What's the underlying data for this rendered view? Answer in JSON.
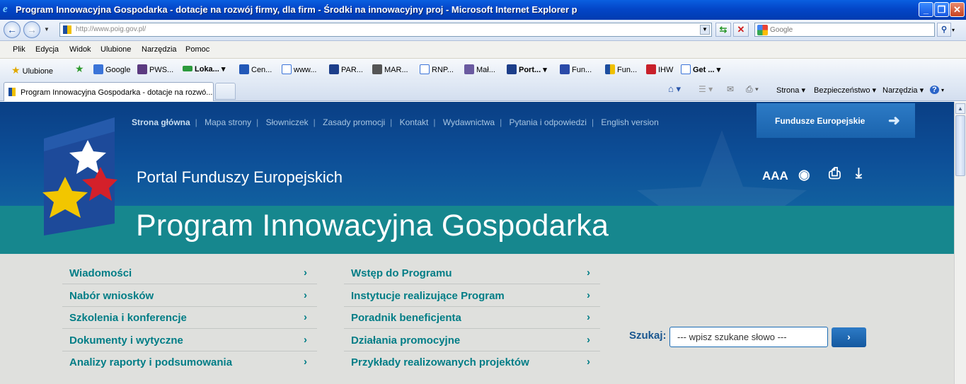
{
  "window": {
    "title": "Program Innowacyjna Gospodarka - dotacje na rozwój firmy, dla firm - Środki na innowacyjny proj - Microsoft Internet Explorer p",
    "minimize": "_",
    "maximize": "❐",
    "close": "✕"
  },
  "address": {
    "url": "http://www.poig.gov.pl/",
    "search_placeholder": "Google"
  },
  "menubar": [
    "Plik",
    "Edycja",
    "Widok",
    "Ulubione",
    "Narzędzia",
    "Pomoc"
  ],
  "favorites": {
    "label": "Ulubione",
    "items": [
      "Google",
      "PWS...",
      "Loka...",
      "Cen...",
      "www...",
      "PAR...",
      "MAR...",
      "RNP...",
      "Mał...",
      "Port...",
      "Fun...",
      "Fun...",
      "IHW",
      "Get ..."
    ]
  },
  "tabs": {
    "active": "Program Innowacyjna Gospodarka - dotacje na rozwó..."
  },
  "commandbar": {
    "strona": "Strona ▾",
    "bezpieczenstwo": "Bezpieczeństwo ▾",
    "narzedzia": "Narzędzia ▾",
    "help": "? ▾"
  },
  "site": {
    "nav": [
      "Strona główna",
      "Mapa strony",
      "Słowniczek",
      "Zasady promocji",
      "Kontakt",
      "Wydawnictwa",
      "Pytania i odpowiedzi",
      "English version"
    ],
    "fundusze": "Fundusze Europejskie",
    "portal": "Portal Funduszy Europejskich",
    "program": "Program Innowacyjna Gospodarka",
    "tools": {
      "font": "AAA",
      "eye": "◉",
      "print": "⎙",
      "download": "⤓"
    },
    "menu_left": [
      "Wiadomości",
      "Nabór wniosków",
      "Szkolenia i konferencje",
      "Dokumenty i wytyczne",
      "Analizy raporty i podsumowania"
    ],
    "menu_right": [
      "Wstęp do Programu",
      "Instytucje realizujące Program",
      "Poradnik beneficjenta",
      "Działania promocyjne",
      "Przykłady realizowanych projektów"
    ],
    "search_label": "Szukaj:",
    "search_value": "--- wpisz szukane słowo ---",
    "search_button": "›",
    "chevron": "›"
  }
}
